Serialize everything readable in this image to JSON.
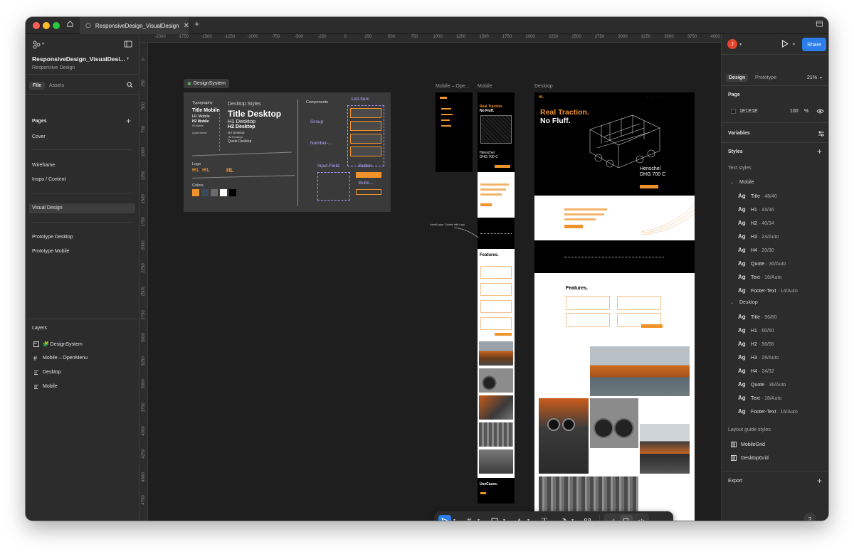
{
  "window": {
    "tab_title": "ResponsiveDesign_VisualDesign",
    "traffic_colors": [
      "#ff5f57",
      "#febc2e",
      "#28c840"
    ]
  },
  "left_panel": {
    "file_title": "ResponsiveDesign_VisualDesi...",
    "project_name": "Responsive Design",
    "tabs": {
      "file": "File",
      "assets": "Assets"
    },
    "pages_heading": "Pages",
    "pages": [
      "Cover",
      "Wireframe",
      "Inspo / Content",
      "Visual Design",
      "Prototype Desktop",
      "Prototype Mobile"
    ],
    "selected_page": "Visual Design",
    "layers_heading": "Layers",
    "layers": [
      {
        "name": "🧩 DesignSystem",
        "icon": "section-icon"
      },
      {
        "name": "Mobile – OpenMenu",
        "icon": "frame-icon"
      },
      {
        "name": "Desktop",
        "icon": "auto-layout-icon"
      },
      {
        "name": "Mobile",
        "icon": "auto-layout-icon"
      }
    ]
  },
  "ruler": {
    "top": [
      "-2000",
      "-1750",
      "-1500",
      "-1250",
      "-1000",
      "-750",
      "-500",
      "-250",
      "0",
      "250",
      "500",
      "750",
      "1000",
      "1250",
      "1500",
      "1750",
      "2000",
      "2250",
      "2500",
      "2750",
      "3000",
      "3250",
      "3500",
      "3750",
      "4000"
    ],
    "left": [
      "0",
      "250",
      "500",
      "750",
      "1000",
      "1250",
      "1500",
      "1750",
      "2000",
      "2250",
      "2500",
      "2750",
      "3000",
      "3250",
      "3500",
      "3750",
      "4000",
      "4250",
      "4500",
      "4750"
    ]
  },
  "canvas": {
    "design_system_label": "DesignSystem",
    "frame_labels": {
      "mobile_open": "Mobile – Ope...",
      "mobile": "Mobile",
      "desktop": "Desktop"
    },
    "ds": {
      "typography": "Typography",
      "desktop_styles": "Desktop Styles",
      "title_desktop": "Title Desktop",
      "h1_desktop": "H1 Desktop",
      "h2_desktop": "H2 Desktop",
      "h3_desktop": "H3 Desktop",
      "h4_desktop": "H4 Desktop",
      "quote_desktop": "Quote Desktop",
      "title_mobile": "Title Mobile",
      "h1_mobile": "H1 Mobile",
      "h2_mobile": "H2 Mobile",
      "h3_mobile": "H3 Mobile",
      "quote_mobile": "Quote Mobile",
      "components": "Components",
      "list_item": "List-Item",
      "group": "Group",
      "number": "Number-...",
      "input_field": "Input-Field",
      "button": "Button",
      "button2": "Butto...",
      "logo": "Logo",
      "colors": "Colors",
      "swatches": [
        "#f0932b",
        "#3b4a5c",
        "#6b6b6b",
        "#ffffff",
        "#000000"
      ]
    },
    "hero_title_line1": "Real Traction.",
    "hero_title_line2": "No Fluff.",
    "hero_sub_line1": "Henschel",
    "hero_sub_line2": "DHG 700 C",
    "features_title": "Features.",
    "usecases_title": "UseCases.",
    "annotation": "Icons/Logos: Colored with Logo",
    "accent_color": "#f0932b"
  },
  "right_panel": {
    "avatar_letter": "J",
    "share_label": "Share",
    "tabs": {
      "design": "Design",
      "prototype": "Prototype"
    },
    "zoom": "21%",
    "page_heading": "Page",
    "page_color": "1E1E1E",
    "page_opacity": "100",
    "page_opacity_unit": "%",
    "variables_label": "Variables",
    "styles_label": "Styles",
    "text_styles_label": "Text styles",
    "mobile_group": "Mobile",
    "mobile_styles": [
      {
        "name": "Title",
        "spec": "48/40"
      },
      {
        "name": "H1",
        "spec": "44/36"
      },
      {
        "name": "H2",
        "spec": "40/34"
      },
      {
        "name": "H3",
        "spec": "24/Auto"
      },
      {
        "name": "H4",
        "spec": "20/30"
      },
      {
        "name": "Quote",
        "spec": "30/Auto"
      },
      {
        "name": "Text",
        "spec": "16/Auto"
      },
      {
        "name": "Footer-Text",
        "spec": "14/Auto"
      }
    ],
    "desktop_group": "Desktop",
    "desktop_styles": [
      {
        "name": "Title",
        "spec": "96/80"
      },
      {
        "name": "H1",
        "spec": "60/50"
      },
      {
        "name": "H2",
        "spec": "56/56"
      },
      {
        "name": "H3",
        "spec": "28/Auto"
      },
      {
        "name": "H4",
        "spec": "24/32"
      },
      {
        "name": "Quote",
        "spec": "36/Auto"
      },
      {
        "name": "Text",
        "spec": "18/Auto"
      },
      {
        "name": "Footer-Text",
        "spec": "16/Auto"
      }
    ],
    "layout_guide_label": "Layout guide styles",
    "layout_guides": [
      "MobileGrid",
      "DesktopGrid"
    ],
    "export_label": "Export",
    "help": "?",
    "share_color": "#2b7de9",
    "avatar_color": "#e2452b"
  }
}
